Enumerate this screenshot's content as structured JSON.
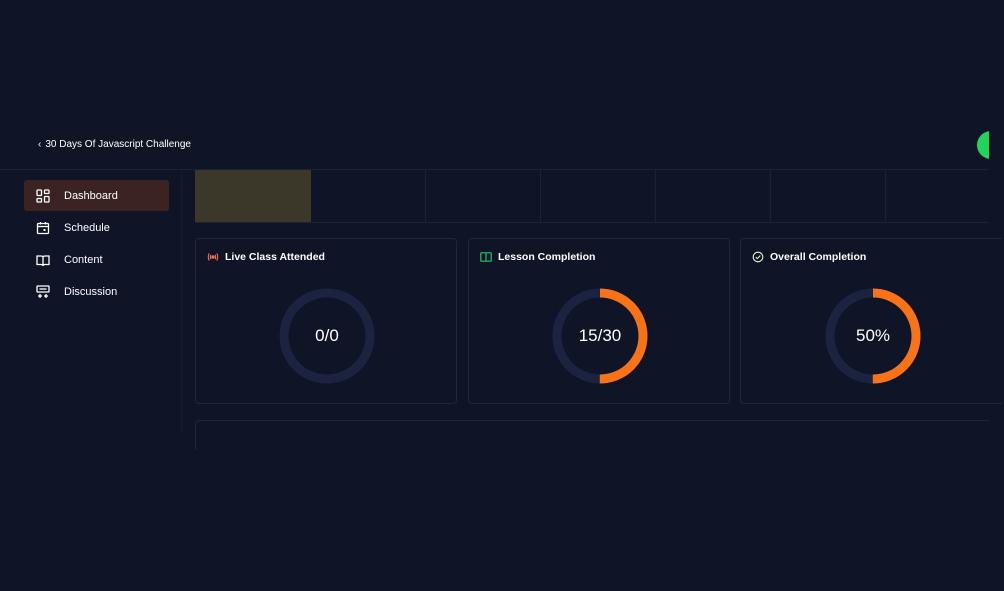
{
  "breadcrumb": {
    "back_label": "30 Days Of Javascript Challenge"
  },
  "sidebar": {
    "items": [
      {
        "label": "Dashboard",
        "icon": "dashboard-icon",
        "active": true
      },
      {
        "label": "Schedule",
        "icon": "calendar-icon",
        "active": false
      },
      {
        "label": "Content",
        "icon": "book-icon",
        "active": false
      },
      {
        "label": "Discussion",
        "icon": "discussion-icon",
        "active": false
      }
    ]
  },
  "cards": [
    {
      "title": "Live Class Attended",
      "icon": "broadcast-icon",
      "icon_color": "#ef6b5a",
      "value_text": "0/0",
      "progress": 0
    },
    {
      "title": "Lesson Completion",
      "icon": "book-open-icon",
      "icon_color": "#22c55e",
      "value_text": "15/30",
      "progress": 0.5
    },
    {
      "title": "Overall Completion",
      "icon": "check-circle-icon",
      "icon_color": "#e7f5c8",
      "value_text": "50%",
      "progress": 0.5
    }
  ],
  "colors": {
    "background": "#0f1427",
    "accent": "#f97316",
    "ring_track": "#1c2340",
    "active_nav": "#3a2320",
    "status_dot": "#22d45a"
  }
}
